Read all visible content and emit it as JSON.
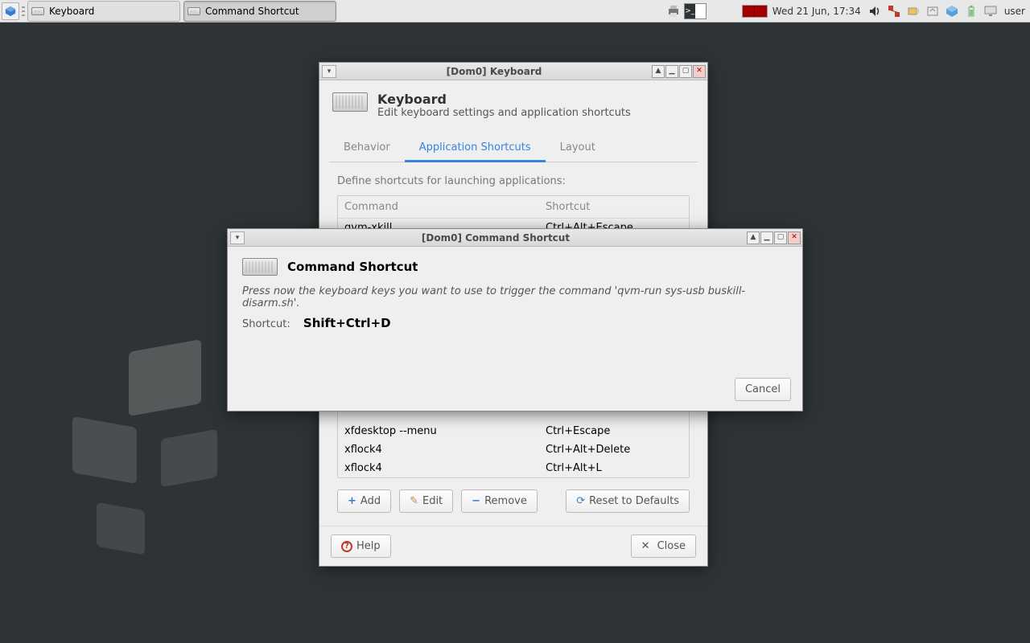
{
  "panel": {
    "taskbar": [
      {
        "label": "Keyboard",
        "active": false
      },
      {
        "label": "Command Shortcut",
        "active": true
      }
    ],
    "datetime": "Wed 21 Jun, 17:34",
    "username": "user"
  },
  "keyboard_window": {
    "title": "[Dom0] Keyboard",
    "header_title": "Keyboard",
    "header_subtitle": "Edit keyboard settings and application shortcuts",
    "tabs": {
      "behavior": "Behavior",
      "app_shortcuts": "Application Shortcuts",
      "layout": "Layout"
    },
    "intro": "Define shortcuts for launching applications:",
    "columns": {
      "command": "Command",
      "shortcut": "Shortcut"
    },
    "rows_before": [
      {
        "command": "qvm-xkill",
        "shortcut": "Ctrl+Alt+Escape"
      }
    ],
    "rows_after": [
      {
        "command": "xfdesktop --menu",
        "shortcut": "Ctrl+Escape"
      },
      {
        "command": "xflock4",
        "shortcut": "Ctrl+Alt+Delete"
      },
      {
        "command": "xflock4",
        "shortcut": "Ctrl+Alt+L"
      }
    ],
    "buttons": {
      "add": "Add",
      "edit": "Edit",
      "remove": "Remove",
      "reset": "Reset to Defaults",
      "help": "Help",
      "close": "Close"
    }
  },
  "cmd_window": {
    "title": "[Dom0] Command Shortcut",
    "header": "Command Shortcut",
    "prompt": "Press now the keyboard keys you want to use to trigger the command 'qvm-run sys-usb buskill-disarm.sh'.",
    "shortcut_label": "Shortcut:",
    "shortcut_value": "Shift+Ctrl+D",
    "cancel": "Cancel"
  }
}
